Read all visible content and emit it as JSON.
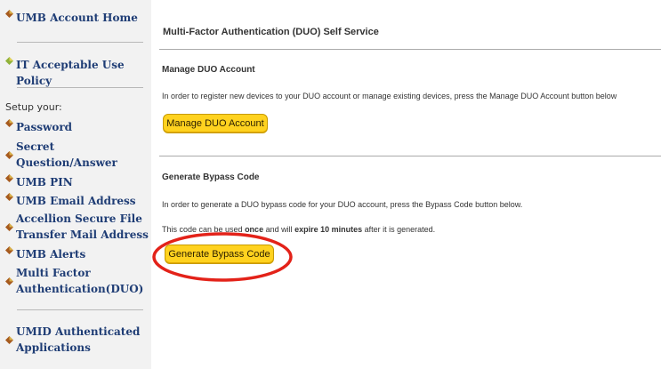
{
  "sidebar": {
    "top_links": [
      {
        "label": "UMB Account Home",
        "icon": "maroon-diamond-icon"
      },
      {
        "label": "IT Acceptable Use Policy",
        "icon": "green-diamond-icon"
      }
    ],
    "setup_label": "Setup your:",
    "items": [
      {
        "line1": "Password"
      },
      {
        "line1": "Secret",
        "line2": "Question/Answer"
      },
      {
        "line1": "UMB PIN"
      },
      {
        "line1": "UMB Email Address"
      },
      {
        "line1": "Accellion Secure File",
        "line2": "Transfer Mail Address"
      },
      {
        "line1": "UMB Alerts"
      },
      {
        "line1": "Multi Factor",
        "line2": "Authentication(DUO)"
      }
    ],
    "bottom_link": {
      "line1": "UMID Authenticated",
      "line2": "Applications"
    }
  },
  "main": {
    "title": "Multi-Factor Authentication (DUO) Self Service",
    "manage": {
      "heading": "Manage DUO Account",
      "description": "In order to register new devices to your DUO account or manage existing devices, press the Manage DUO Account button below",
      "button": "Manage DUO Account"
    },
    "bypass": {
      "heading": "Generate Bypass Code",
      "description": "In order to generate a DUO bypass code for your DUO account, press the Bypass Code button below.",
      "note_prefix": "This code can be used ",
      "note_once": "once",
      "note_middle": " and will ",
      "note_expire": "expire 10 minutes",
      "note_suffix": " after it is generated.",
      "button": "Generate Bypass Code"
    }
  },
  "colors": {
    "link": "#1f3d75",
    "button": "#ffd21f",
    "highlight": "#e32219",
    "icon_maroon": "#a65a1e",
    "icon_green": "#8fb23a"
  }
}
